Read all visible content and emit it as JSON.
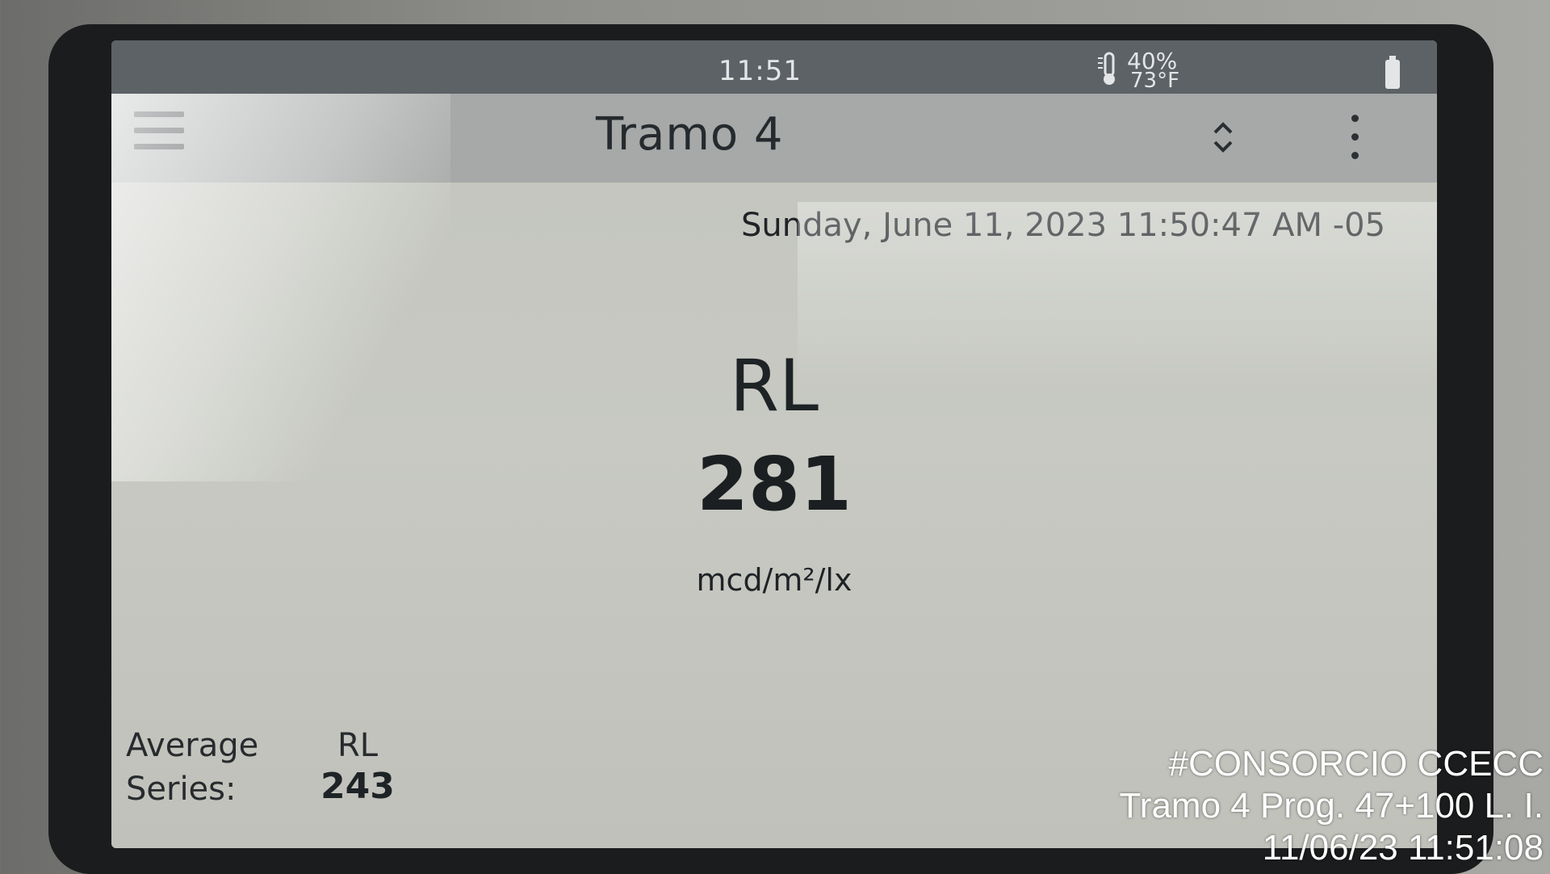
{
  "status_bar": {
    "time": "11:51",
    "humidity": "40%",
    "temperature": "73°F",
    "thermometer_icon": "thermometer-icon",
    "battery_icon": "battery-icon"
  },
  "app_bar": {
    "menu_icon": "hamburger-menu-icon",
    "title": "Tramo 4",
    "selector_icon": "up-down-chevron-icon",
    "selector_glyph": "⌃⌄",
    "overflow_icon": "vertical-dots-icon"
  },
  "main": {
    "timestamp": "Sunday, June 11, 2023 11:50:47 AM -05",
    "metric_label": "RL",
    "metric_value": "281",
    "metric_unit": "mcd/m²/lx",
    "average": {
      "label_line1": "Average",
      "label_line2": "Series:",
      "metric": "RL",
      "value": "243"
    }
  },
  "watermark": {
    "line1": "#CONSORCIO CCECC",
    "line2": "Tramo 4 Prog. 47+100 L. I.",
    "line3": "11/06/23  11:51:08"
  },
  "colors": {
    "status_bar": "#5d6266",
    "app_bar": "#a6a9a8",
    "screen_bg": "#c9cbc2",
    "text": "#1f2326"
  }
}
